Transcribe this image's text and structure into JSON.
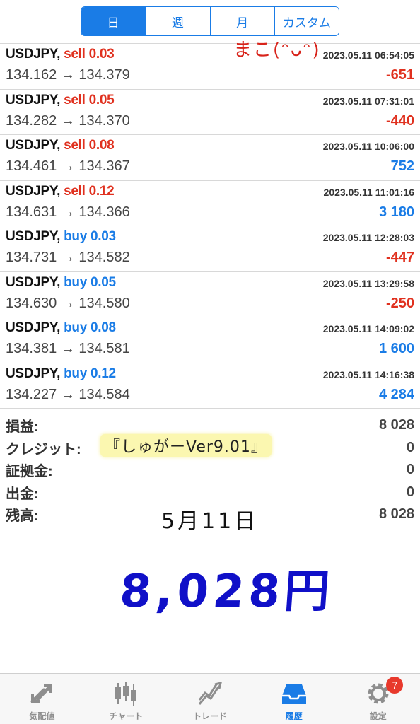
{
  "segments": [
    {
      "label": "日",
      "active": true
    },
    {
      "label": "週",
      "active": false
    },
    {
      "label": "月",
      "active": false
    },
    {
      "label": "カスタム",
      "active": false
    }
  ],
  "trades": [
    {
      "symbol": "USDJPY,",
      "side": "sell",
      "lots": "0.03",
      "time": "2023.05.11 06:54:05",
      "prices": "134.162 → 134.379",
      "profit": "-651",
      "profit_sign": "neg"
    },
    {
      "symbol": "USDJPY,",
      "side": "sell",
      "lots": "0.05",
      "time": "2023.05.11 07:31:01",
      "prices": "134.282 → 134.370",
      "profit": "-440",
      "profit_sign": "neg"
    },
    {
      "symbol": "USDJPY,",
      "side": "sell",
      "lots": "0.08",
      "time": "2023.05.11 10:06:00",
      "prices": "134.461 → 134.367",
      "profit": "752",
      "profit_sign": "pos"
    },
    {
      "symbol": "USDJPY,",
      "side": "sell",
      "lots": "0.12",
      "time": "2023.05.11 11:01:16",
      "prices": "134.631 → 134.366",
      "profit": "3 180",
      "profit_sign": "pos"
    },
    {
      "symbol": "USDJPY,",
      "side": "buy",
      "lots": "0.03",
      "time": "2023.05.11 12:28:03",
      "prices": "134.731 → 134.582",
      "profit": "-447",
      "profit_sign": "neg"
    },
    {
      "symbol": "USDJPY,",
      "side": "buy",
      "lots": "0.05",
      "time": "2023.05.11 13:29:58",
      "prices": "134.630 → 134.580",
      "profit": "-250",
      "profit_sign": "neg"
    },
    {
      "symbol": "USDJPY,",
      "side": "buy",
      "lots": "0.08",
      "time": "2023.05.11 14:09:02",
      "prices": "134.381 → 134.581",
      "profit": "1 600",
      "profit_sign": "pos"
    },
    {
      "symbol": "USDJPY,",
      "side": "buy",
      "lots": "0.12",
      "time": "2023.05.11 14:16:38",
      "prices": "134.227 → 134.584",
      "profit": "4 284",
      "profit_sign": "pos"
    }
  ],
  "summary": [
    {
      "label": "損益:",
      "value": "8 028"
    },
    {
      "label": "クレジット:",
      "value": "0"
    },
    {
      "label": "証拠金:",
      "value": "0"
    },
    {
      "label": "出金:",
      "value": "0"
    },
    {
      "label": "残高:",
      "value": "8 028"
    }
  ],
  "handwriting": {
    "name": "まこ(ᵔᴗᵔ)",
    "ea": "『しゅがーVer9.01』",
    "date": "5月11日",
    "total": "8,028円"
  },
  "tabs": [
    {
      "label": "気配値",
      "icon": "quotes-icon",
      "active": false
    },
    {
      "label": "チャート",
      "icon": "chart-icon",
      "active": false
    },
    {
      "label": "トレード",
      "icon": "trade-icon",
      "active": false
    },
    {
      "label": "履歴",
      "icon": "history-icon",
      "active": true
    },
    {
      "label": "設定",
      "icon": "settings-icon",
      "active": false,
      "badge": "7"
    }
  ],
  "colors": {
    "accent": "#1a7ce6",
    "sell": "#e0301e",
    "buy": "#1a7ce6",
    "loss": "#e0301e",
    "gain": "#1a7ce6",
    "badge": "#e8392c"
  }
}
